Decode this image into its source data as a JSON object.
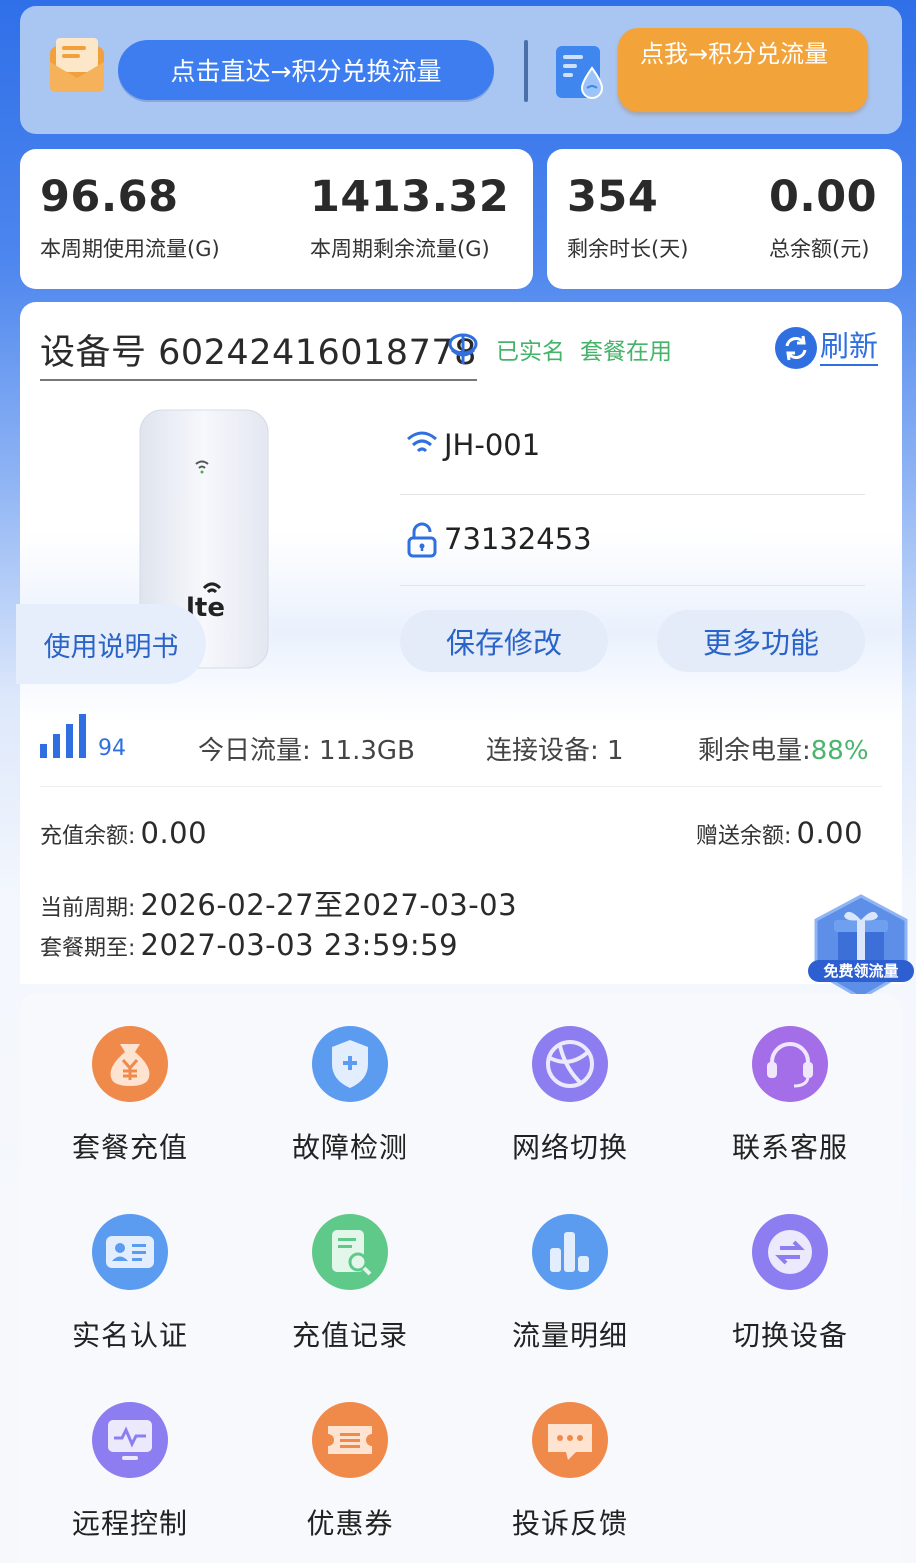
{
  "banner": {
    "left_button": "点击直达→积分兑换流量",
    "right_button": "点我→积分兑流量",
    "colors": {
      "blue_pill": "#3d7df0",
      "orange_pill": "#f2a33a"
    }
  },
  "stats": {
    "used": {
      "value": "96.68",
      "label": "本周期使用流量(G)"
    },
    "remaining": {
      "value": "1413.32",
      "label": "本周期剩余流量(G)"
    },
    "days_left": {
      "value": "354",
      "label": "剩余时长(天)"
    },
    "balance": {
      "value": "0.00",
      "label": "总余额(元)"
    }
  },
  "device": {
    "title": "设备号 60242416018778",
    "verified": "已实名",
    "plan_status": "套餐在用",
    "refresh": "刷新",
    "ssid": "JH-001",
    "password": "73132453",
    "save_button": "保存修改",
    "more_button": "更多功能",
    "manual": "使用说明书",
    "device_logo_text": "lte",
    "signal": "94",
    "today_flow": "今日流量: 11.3GB",
    "connected": "连接设备: 1",
    "battery_label": "剩余电量:",
    "battery_value": "88%"
  },
  "account": {
    "recharge_label": "充值余额:",
    "recharge_value": "0.00",
    "gift_label": "赠送余额:",
    "gift_value": "0.00",
    "period_label": "当前周期:",
    "period_value": "2026-02-27至2027-03-03",
    "expire_label": "套餐期至:",
    "expire_value": "2027-03-03 23:59:59"
  },
  "gift_badge": "免费领流量",
  "functions": [
    {
      "label": "套餐充值",
      "icon": "money-bag-icon",
      "color": "#f08a4b"
    },
    {
      "label": "故障检测",
      "icon": "shield-plus-icon",
      "color": "#5b9cf0"
    },
    {
      "label": "网络切换",
      "icon": "globe-icon",
      "color": "#8c7ef0"
    },
    {
      "label": "联系客服",
      "icon": "headset-icon",
      "color": "#a46ee8"
    },
    {
      "label": "实名认证",
      "icon": "id-card-icon",
      "color": "#5b9cf0"
    },
    {
      "label": "充值记录",
      "icon": "receipt-search-icon",
      "color": "#5fc98a"
    },
    {
      "label": "流量明细",
      "icon": "bar-chart-icon",
      "color": "#5b9cf0"
    },
    {
      "label": "切换设备",
      "icon": "switch-arrows-icon",
      "color": "#8c7ef0"
    },
    {
      "label": "远程控制",
      "icon": "monitor-icon",
      "color": "#8c7ef0"
    },
    {
      "label": "优惠券",
      "icon": "coupon-icon",
      "color": "#f08a4b"
    },
    {
      "label": "投诉反馈",
      "icon": "chat-bubble-icon",
      "color": "#f08a4b"
    }
  ]
}
